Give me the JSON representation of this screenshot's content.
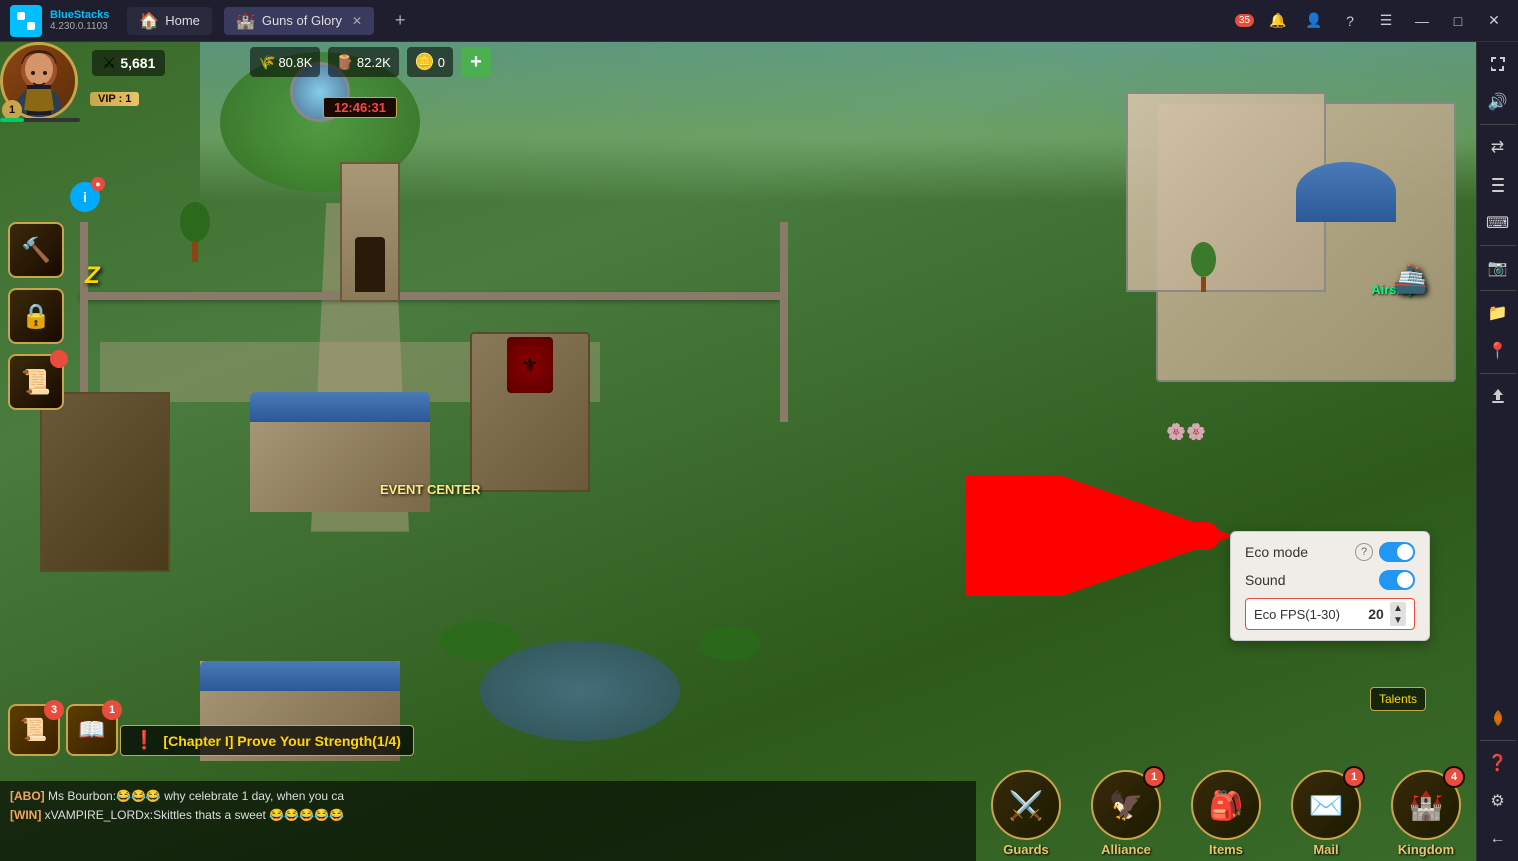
{
  "app": {
    "name": "BlueStacks",
    "version": "4.230.0.1103"
  },
  "titlebar": {
    "tabs": [
      {
        "label": "Home",
        "icon": "🏠",
        "active": false
      },
      {
        "label": "Guns of Glory",
        "icon": "🏰",
        "active": true
      }
    ],
    "controls": {
      "notifications_label": "🔔",
      "notifications_count": "35",
      "user_icon": "👤",
      "help_icon": "?",
      "menu_icon": "☰",
      "minimize_icon": "—",
      "maximize_icon": "□",
      "close_icon": "✕"
    }
  },
  "game": {
    "title": "Guns of Glory",
    "player": {
      "level": "1",
      "vip_level": "VIP : 1",
      "power": "5,681",
      "avatar_emoji": "🧔"
    },
    "timer": "12:46:31",
    "resources": {
      "food": "80.8K",
      "wood": "82.2K",
      "gold": "0"
    },
    "map_labels": {
      "event_center": "EVENT CENTER",
      "airship": "Airship",
      "talents": "Talents"
    },
    "quests": [
      {
        "badge": "3",
        "icon": "📜"
      },
      {
        "badge": "1",
        "icon": "📖"
      }
    ],
    "quest_banner": "[Chapter I] Prove Your Strength(1/4)",
    "chat_messages": [
      {
        "tag": "[ABO]",
        "text": " Ms Bourbon:😂😂😂 why celebrate 1 day, when you ca"
      },
      {
        "tag": "[WIN]",
        "text": " xVAMPIRE_LORDx:Skittles thats a sweet 😂😂😂😂😂"
      }
    ],
    "bottom_nav": [
      {
        "label": "Guards",
        "badge": "",
        "icon": "⚔️"
      },
      {
        "label": "Alliance",
        "badge": "1",
        "icon": "🦅"
      },
      {
        "label": "Items",
        "badge": "",
        "icon": "🎒"
      },
      {
        "label": "Mail",
        "badge": "1",
        "icon": "✉️"
      },
      {
        "label": "Kingdom",
        "badge": "4",
        "icon": "🏰"
      }
    ]
  },
  "eco_popup": {
    "eco_mode_label": "Eco mode",
    "eco_mode_on": true,
    "sound_label": "Sound",
    "sound_on": true,
    "fps_label": "Eco FPS(1-30)",
    "fps_value": "20",
    "help_icon": "?"
  },
  "sidebar": {
    "buttons": [
      {
        "icon": "🔊",
        "name": "volume"
      },
      {
        "icon": "⇄",
        "name": "rotate"
      },
      {
        "icon": "📷",
        "name": "screenshot"
      },
      {
        "icon": "⌨",
        "name": "keyboard"
      },
      {
        "icon": "📁",
        "name": "files"
      },
      {
        "icon": "📍",
        "name": "location"
      },
      {
        "icon": "⬆",
        "name": "import"
      },
      {
        "icon": "❓",
        "name": "help"
      },
      {
        "icon": "⚙",
        "name": "settings"
      },
      {
        "icon": "←",
        "name": "back"
      }
    ]
  }
}
